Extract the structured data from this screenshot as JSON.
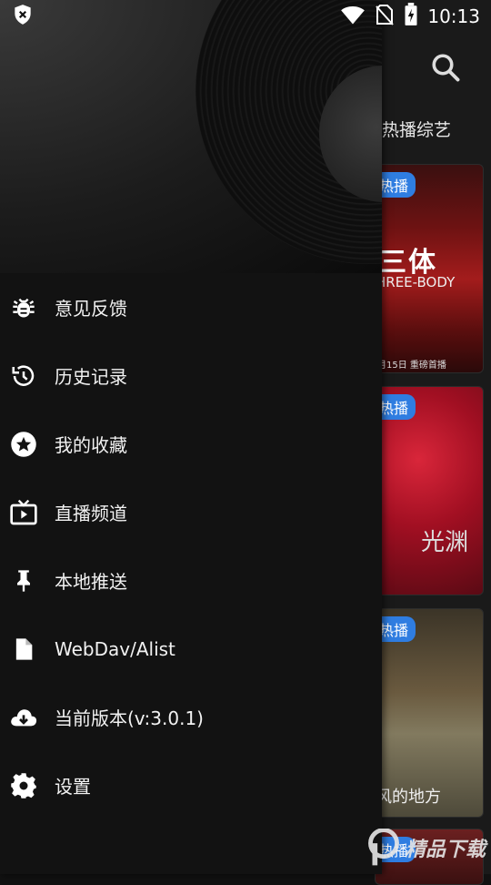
{
  "status_bar": {
    "time": "10:13",
    "icons": [
      "shield-x-icon",
      "wifi-icon",
      "no-sim-icon",
      "battery-charging-icon"
    ]
  },
  "background_app": {
    "tab_label": "热播综艺",
    "posters": [
      {
        "badge": "热播",
        "big_text": "三体",
        "sub_text": "HREE-BODY",
        "date_text": "月15日 重磅首播",
        "title": ""
      },
      {
        "badge": "热播",
        "big_text": "",
        "sub_text": "光渊",
        "date_text": "",
        "title": ""
      },
      {
        "badge": "热播",
        "big_text": "",
        "sub_text": "",
        "date_text": "",
        "title": "风的地方"
      },
      {
        "badge": "热播",
        "big_text": "",
        "sub_text": "",
        "date_text": "",
        "title": ""
      }
    ]
  },
  "drawer": {
    "menu": [
      {
        "label": "意见反馈",
        "icon": "bug-icon"
      },
      {
        "label": "历史记录",
        "icon": "history-icon"
      },
      {
        "label": "我的收藏",
        "icon": "star-icon"
      },
      {
        "label": "直播频道",
        "icon": "live-tv-icon"
      },
      {
        "label": "本地推送",
        "icon": "pin-icon"
      },
      {
        "label": "WebDav/Alist",
        "icon": "file-icon"
      },
      {
        "label": "当前版本(v:3.0.1)",
        "icon": "cloud-download-icon"
      },
      {
        "label": "设置",
        "icon": "settings-icon"
      }
    ]
  },
  "watermark": {
    "text": "精品下载"
  },
  "colors": {
    "badge": "#2f7de1",
    "drawer_bg": "#121212"
  }
}
